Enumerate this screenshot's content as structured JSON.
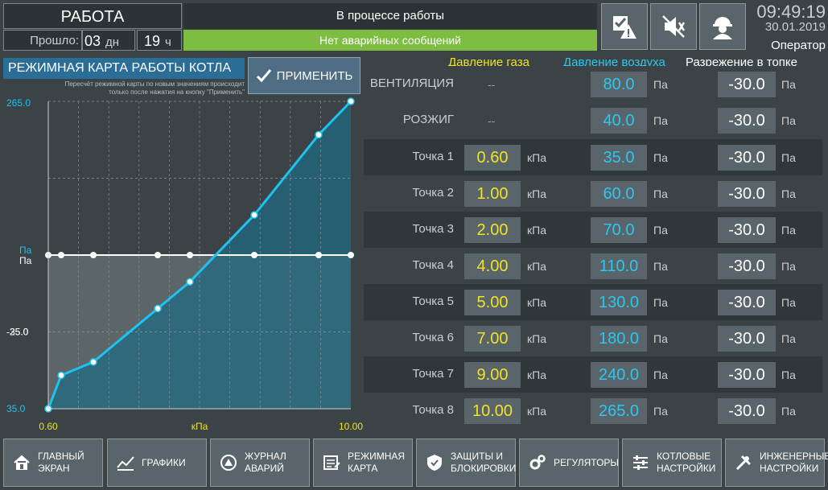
{
  "header": {
    "mode": "РАБОТА",
    "elapsed_label": "Прошло:",
    "elapsed_days": "03",
    "days_unit": "дн",
    "elapsed_hours": "19",
    "hours_unit": "ч",
    "process_state": "В процессе работы",
    "alarm_status": "Нет аварийных сообщений",
    "time": "09:49:19",
    "date": "30.01.2019",
    "user": "Оператор"
  },
  "map": {
    "title": "РЕЖИМНАЯ КАРТА РАБОТЫ КОТЛА",
    "note_line1": "Пересчёт режимной карты по новым значениям происходит",
    "note_line2": "только после нажатия на кнопку \"Применить\"",
    "apply_label": "ПРИМЕНИТЬ"
  },
  "columns": {
    "gas": "Давление газа",
    "air": "Давление воздуха",
    "vac": "Разрежение в топке"
  },
  "units": {
    "kpa": "кПа",
    "pa": "Па"
  },
  "rows": [
    {
      "label": "ВЕНТИЛЯЦИЯ",
      "gas": "--",
      "air": "80.0",
      "vac": "-30.0"
    },
    {
      "label": "РОЗЖИГ",
      "gas": "--",
      "air": "40.0",
      "vac": "-30.0"
    },
    {
      "label": "Точка 1",
      "gas": "0.60",
      "air": "35.0",
      "vac": "-30.0"
    },
    {
      "label": "Точка 2",
      "gas": "1.00",
      "air": "60.0",
      "vac": "-30.0"
    },
    {
      "label": "Точка 3",
      "gas": "2.00",
      "air": "70.0",
      "vac": "-30.0"
    },
    {
      "label": "Точка 4",
      "gas": "4.00",
      "air": "110.0",
      "vac": "-30.0"
    },
    {
      "label": "Точка 5",
      "gas": "5.00",
      "air": "130.0",
      "vac": "-30.0"
    },
    {
      "label": "Точка 6",
      "gas": "7.00",
      "air": "180.0",
      "vac": "-30.0"
    },
    {
      "label": "Точка 7",
      "gas": "9.00",
      "air": "240.0",
      "vac": "-30.0"
    },
    {
      "label": "Точка 8",
      "gas": "10.00",
      "air": "265.0",
      "vac": "-30.0"
    }
  ],
  "chart_data": {
    "type": "line",
    "x": [
      0.6,
      1.0,
      2.0,
      4.0,
      5.0,
      7.0,
      9.0,
      10.0
    ],
    "x_tick_labels": [
      "0.60",
      "10.00"
    ],
    "xlabel": "кПа",
    "xlim": [
      0.6,
      10.0
    ],
    "series": [
      {
        "axis": "left",
        "color": "#1fc3f0",
        "values": [
          35.0,
          60.0,
          70.0,
          110.0,
          130.0,
          180.0,
          240.0,
          265.0
        ],
        "ylim": [
          35.0,
          265.0
        ]
      },
      {
        "axis": "right",
        "color": "#ffffff",
        "values": [
          -30.0,
          -30.0,
          -30.0,
          -30.0,
          -30.0,
          -30.0,
          -30.0,
          -30.0
        ],
        "ylim": [
          -35.0,
          -25.0
        ]
      }
    ],
    "left_ticks": [
      "265.0",
      "35.0"
    ],
    "right_ticks": [
      "-25.0",
      "-35.0"
    ],
    "axis_unit_left": "Па",
    "axis_unit_right": "Па",
    "grid": true
  },
  "nav": [
    {
      "line1": "ГЛАВНЫЙ",
      "line2": "ЭКРАН",
      "icon": "home-icon"
    },
    {
      "line1": "ГРАФИКИ",
      "line2": "",
      "icon": "chart-icon"
    },
    {
      "line1": "ЖУРНАЛ",
      "line2": "АВАРИЙ",
      "icon": "alarm-log-icon"
    },
    {
      "line1": "РЕЖИМНАЯ",
      "line2": "КАРТА",
      "icon": "map-icon"
    },
    {
      "line1": "ЗАЩИТЫ И",
      "line2": "БЛОКИРОВКИ",
      "icon": "shield-icon"
    },
    {
      "line1": "РЕГУЛЯТОРЫ",
      "line2": "",
      "icon": "gears-icon"
    },
    {
      "line1": "КОТЛОВЫЕ",
      "line2": "НАСТРОЙКИ",
      "icon": "sliders-icon"
    },
    {
      "line1": "ИНЖЕНЕРНЫЕ",
      "line2": "НАСТРОЙКИ",
      "icon": "tools-icon"
    }
  ],
  "colors": {
    "gas": "#f0e224",
    "air": "#2cc7ef",
    "accent": "#2a6e98",
    "ok": "#7cbd42"
  }
}
